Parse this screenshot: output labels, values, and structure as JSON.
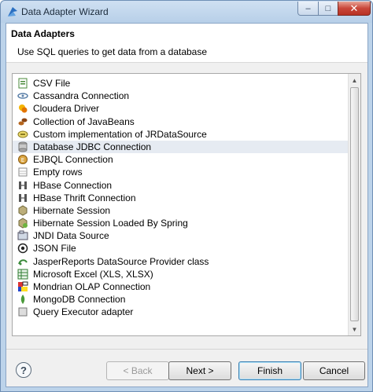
{
  "window": {
    "title": "Data Adapter Wizard",
    "close_glyph": "✕",
    "min_glyph": "–",
    "max_glyph": "□"
  },
  "header": {
    "title": "Data Adapters",
    "description": "Use SQL queries to get data from a database"
  },
  "list": {
    "selected_index": 5,
    "items": [
      {
        "label": "CSV File",
        "icon": "csv-file-icon"
      },
      {
        "label": "Cassandra Connection",
        "icon": "cassandra-icon"
      },
      {
        "label": "Cloudera Driver",
        "icon": "cloudera-icon"
      },
      {
        "label": "Collection of JavaBeans",
        "icon": "javabeans-icon"
      },
      {
        "label": "Custom implementation of JRDataSource",
        "icon": "custom-datasource-icon"
      },
      {
        "label": "Database JDBC Connection",
        "icon": "database-icon"
      },
      {
        "label": "EJBQL Connection",
        "icon": "ejbql-icon"
      },
      {
        "label": "Empty rows",
        "icon": "empty-rows-icon"
      },
      {
        "label": "HBase Connection",
        "icon": "hbase-icon"
      },
      {
        "label": "HBase Thrift Connection",
        "icon": "hbase-thrift-icon"
      },
      {
        "label": "Hibernate Session",
        "icon": "hibernate-icon"
      },
      {
        "label": "Hibernate Session Loaded By Spring",
        "icon": "hibernate-spring-icon"
      },
      {
        "label": "JNDI Data Source",
        "icon": "jndi-icon"
      },
      {
        "label": "JSON File",
        "icon": "json-icon"
      },
      {
        "label": "JasperReports DataSource Provider class",
        "icon": "jasper-provider-icon"
      },
      {
        "label": "Microsoft Excel (XLS, XLSX)",
        "icon": "excel-icon"
      },
      {
        "label": "Mondrian OLAP Connection",
        "icon": "mondrian-icon"
      },
      {
        "label": "MongoDB Connection",
        "icon": "mongodb-icon"
      },
      {
        "label": "Query Executor adapter",
        "icon": "query-executor-icon"
      }
    ]
  },
  "buttons": {
    "help": "?",
    "back": "< Back",
    "next": "Next >",
    "finish": "Finish",
    "cancel": "Cancel"
  },
  "colors": {
    "selection": "#e6ebf2",
    "close_red": "#c9473a",
    "default_button_border": "#3c7fb1"
  }
}
